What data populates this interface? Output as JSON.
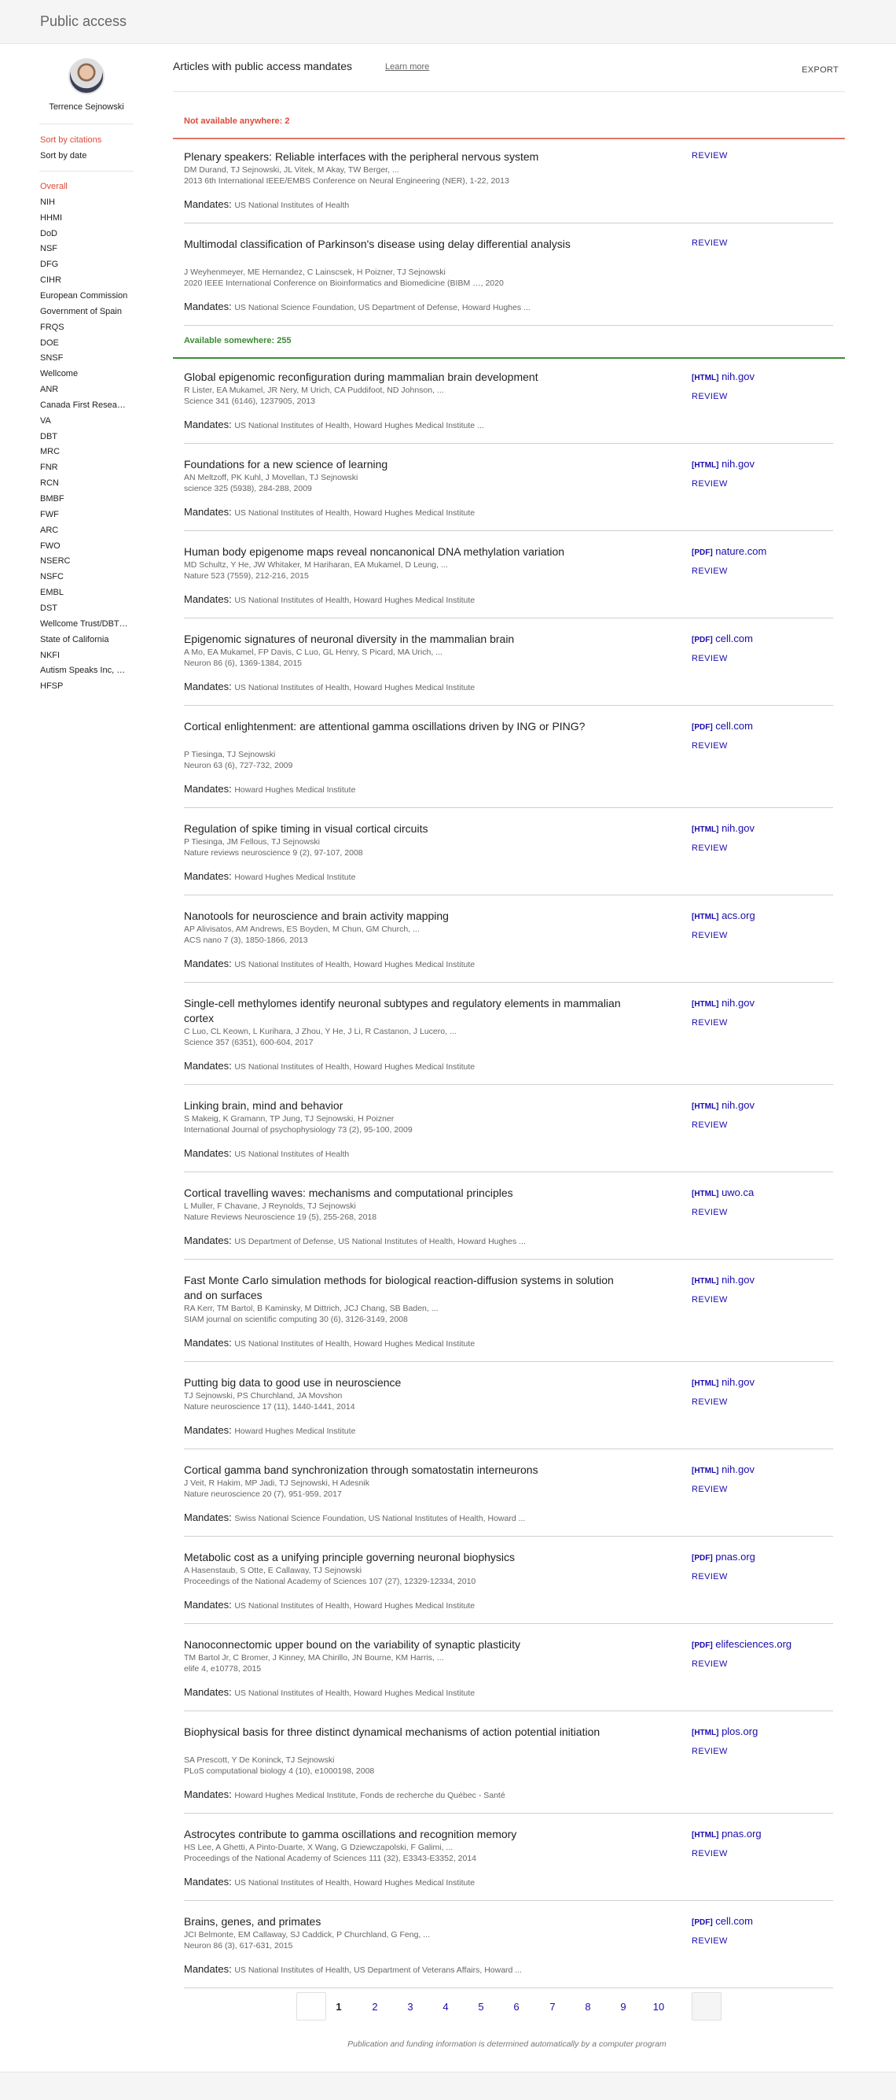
{
  "app": {
    "title": "Public access"
  },
  "profile": {
    "name": "Terrence Sejnowski"
  },
  "sort": {
    "by_citations": "Sort by citations",
    "by_date": "Sort by date"
  },
  "filters": [
    "Overall",
    "NIH",
    "HHMI",
    "DoD",
    "NSF",
    "DFG",
    "CIHR",
    "European Commission",
    "Government of Spain",
    "FRQS",
    "DOE",
    "SNSF",
    "Wellcome",
    "ANR",
    "Canada First Resea…",
    "VA",
    "DBT",
    "MRC",
    "FNR",
    "RCN",
    "BMBF",
    "FWF",
    "ARC",
    "FWO",
    "NSERC",
    "NSFC",
    "EMBL",
    "DST",
    "Wellcome Trust/DBT…",
    "State of California",
    "NKFI",
    "Autism Speaks Inc, …",
    "HFSP"
  ],
  "header": {
    "title": "Articles with public access mandates",
    "learn_more": "Learn more",
    "export": "EXPORT"
  },
  "mandates_label": "Mandates:",
  "review_label": "REVIEW",
  "sections": {
    "not_available": "Not available anywhere: 2",
    "available": "Available somewhere: 255"
  },
  "not_available_articles": [
    {
      "title": "Plenary speakers: Reliable interfaces with the peripheral nervous system",
      "authors": "DM Durand, TJ Sejnowski, JL Vitek, M Akay, TW Berger, ...",
      "venue": "2013 6th International IEEE/EMBS Conference on Neural Engineering (NER), 1-22, 2013",
      "mandates": "US National Institutes of Health"
    },
    {
      "title": "Multimodal classification of Parkinson's disease using delay differential analysis",
      "authors": "J Weyhenmeyer, ME Hernandez, C Lainscsek, H Poizner, TJ Sejnowski",
      "venue": "2020 IEEE International Conference on Bioinformatics and Biomedicine (BIBM …, 2020",
      "mandates": "US National Science Foundation, US Department of Defense, Howard Hughes ..."
    }
  ],
  "available_articles": [
    {
      "title": "Global epigenomic reconfiguration during mammalian brain development",
      "authors": "R Lister, EA Mukamel, JR Nery, M Urich, CA Puddifoot, ND Johnson, ...",
      "venue": "Science 341 (6146), 1237905, 2013",
      "mandates": "US National Institutes of Health, Howard Hughes Medical Institute ...",
      "link_type": "[HTML]",
      "link_domain": "nih.gov"
    },
    {
      "title": "Foundations for a new science of learning",
      "authors": "AN Meltzoff, PK Kuhl, J Movellan, TJ Sejnowski",
      "venue": "science 325 (5938), 284-288, 2009",
      "mandates": "US National Institutes of Health, Howard Hughes Medical Institute",
      "link_type": "[HTML]",
      "link_domain": "nih.gov"
    },
    {
      "title": "Human body epigenome maps reveal noncanonical DNA methylation variation",
      "authors": "MD Schultz, Y He, JW Whitaker, M Hariharan, EA Mukamel, D Leung, ...",
      "venue": "Nature 523 (7559), 212-216, 2015",
      "mandates": "US National Institutes of Health, Howard Hughes Medical Institute",
      "link_type": "[PDF]",
      "link_domain": "nature.com"
    },
    {
      "title": "Epigenomic signatures of neuronal diversity in the mammalian brain",
      "authors": "A Mo, EA Mukamel, FP Davis, C Luo, GL Henry, S Picard, MA Urich, ...",
      "venue": "Neuron 86 (6), 1369-1384, 2015",
      "mandates": "US National Institutes of Health, Howard Hughes Medical Institute",
      "link_type": "[PDF]",
      "link_domain": "cell.com"
    },
    {
      "title": "Cortical enlightenment: are attentional gamma oscillations driven by ING or PING?",
      "authors": "P Tiesinga, TJ Sejnowski",
      "venue": "Neuron 63 (6), 727-732, 2009",
      "mandates": "Howard Hughes Medical Institute",
      "link_type": "[PDF]",
      "link_domain": "cell.com"
    },
    {
      "title": "Regulation of spike timing in visual cortical circuits",
      "authors": "P Tiesinga, JM Fellous, TJ Sejnowski",
      "venue": "Nature reviews neuroscience 9 (2), 97-107, 2008",
      "mandates": "Howard Hughes Medical Institute",
      "link_type": "[HTML]",
      "link_domain": "nih.gov"
    },
    {
      "title": "Nanotools for neuroscience and brain activity mapping",
      "authors": "AP Alivisatos, AM Andrews, ES Boyden, M Chun, GM Church, ...",
      "venue": "ACS nano 7 (3), 1850-1866, 2013",
      "mandates": "US National Institutes of Health, Howard Hughes Medical Institute",
      "link_type": "[HTML]",
      "link_domain": "acs.org"
    },
    {
      "title": "Single-cell methylomes identify neuronal subtypes and regulatory elements in mammalian cortex",
      "authors": "C Luo, CL Keown, L Kurihara, J Zhou, Y He, J Li, R Castanon, J Lucero, ...",
      "venue": "Science 357 (6351), 600-604, 2017",
      "mandates": "US National Institutes of Health, Howard Hughes Medical Institute",
      "link_type": "[HTML]",
      "link_domain": "nih.gov"
    },
    {
      "title": "Linking brain, mind and behavior",
      "authors": "S Makeig, K Gramann, TP Jung, TJ Sejnowski, H Poizner",
      "venue": "International Journal of psychophysiology 73 (2), 95-100, 2009",
      "mandates": "US National Institutes of Health",
      "link_type": "[HTML]",
      "link_domain": "nih.gov"
    },
    {
      "title": "Cortical travelling waves: mechanisms and computational principles",
      "authors": "L Muller, F Chavane, J Reynolds, TJ Sejnowski",
      "venue": "Nature Reviews Neuroscience 19 (5), 255-268, 2018",
      "mandates": "US Department of Defense, US National Institutes of Health, Howard Hughes ...",
      "link_type": "[HTML]",
      "link_domain": "uwo.ca"
    },
    {
      "title": "Fast Monte Carlo simulation methods for biological reaction-diffusion systems in solution and on surfaces",
      "authors": "RA Kerr, TM Bartol, B Kaminsky, M Dittrich, JCJ Chang, SB Baden, ...",
      "venue": "SIAM journal on scientific computing 30 (6), 3126-3149, 2008",
      "mandates": "US National Institutes of Health, Howard Hughes Medical Institute",
      "link_type": "[HTML]",
      "link_domain": "nih.gov"
    },
    {
      "title": "Putting big data to good use in neuroscience",
      "authors": "TJ Sejnowski, PS Churchland, JA Movshon",
      "venue": "Nature neuroscience 17 (11), 1440-1441, 2014",
      "mandates": "Howard Hughes Medical Institute",
      "link_type": "[HTML]",
      "link_domain": "nih.gov"
    },
    {
      "title": "Cortical gamma band synchronization through somatostatin interneurons",
      "authors": "J Veit, R Hakim, MP Jadi, TJ Sejnowski, H Adesnik",
      "venue": "Nature neuroscience 20 (7), 951-959, 2017",
      "mandates": "Swiss National Science Foundation, US National Institutes of Health, Howard ...",
      "link_type": "[HTML]",
      "link_domain": "nih.gov"
    },
    {
      "title": "Metabolic cost as a unifying principle governing neuronal biophysics",
      "authors": "A Hasenstaub, S Otte, E Callaway, TJ Sejnowski",
      "venue": "Proceedings of the National Academy of Sciences 107 (27), 12329-12334, 2010",
      "mandates": "US National Institutes of Health, Howard Hughes Medical Institute",
      "link_type": "[PDF]",
      "link_domain": "pnas.org"
    },
    {
      "title": "Nanoconnectomic upper bound on the variability of synaptic plasticity",
      "authors": "TM Bartol Jr, C Bromer, J Kinney, MA Chirillo, JN Bourne, KM Harris, ...",
      "venue": "elife 4, e10778, 2015",
      "mandates": "US National Institutes of Health, Howard Hughes Medical Institute",
      "link_type": "[PDF]",
      "link_domain": "elifesciences.org"
    },
    {
      "title": "Biophysical basis for three distinct dynamical mechanisms of action potential initiation",
      "authors": "SA Prescott, Y De Koninck, TJ Sejnowski",
      "venue": "PLoS computational biology 4 (10), e1000198, 2008",
      "mandates": "Howard Hughes Medical Institute, Fonds de recherche du Québec - Santé",
      "link_type": "[HTML]",
      "link_domain": "plos.org"
    },
    {
      "title": "Astrocytes contribute to gamma oscillations and recognition memory",
      "authors": "HS Lee, A Ghetti, A Pinto-Duarte, X Wang, G Dziewczapolski, F Galimi, ...",
      "venue": "Proceedings of the National Academy of Sciences 111 (32), E3343-E3352, 2014",
      "mandates": "US National Institutes of Health, Howard Hughes Medical Institute",
      "link_type": "[HTML]",
      "link_domain": "pnas.org"
    },
    {
      "title": "Brains, genes, and primates",
      "authors": "JCI Belmonte, EM Callaway, SJ Caddick, P Churchland, G Feng, ...",
      "venue": "Neuron 86 (3), 617-631, 2015",
      "mandates": "US National Institutes of Health, US Department of Veterans Affairs, Howard ...",
      "link_type": "[PDF]",
      "link_domain": "cell.com"
    }
  ],
  "pagination": {
    "pages": [
      "1",
      "2",
      "3",
      "4",
      "5",
      "6",
      "7",
      "8",
      "9",
      "10"
    ],
    "current": "1"
  },
  "footnote": "Publication and funding information is determined automatically by a computer program",
  "colors": {
    "accent_red": "#dd4b39",
    "accent_green": "#3d8b37",
    "link_blue": "#1a0dab"
  }
}
